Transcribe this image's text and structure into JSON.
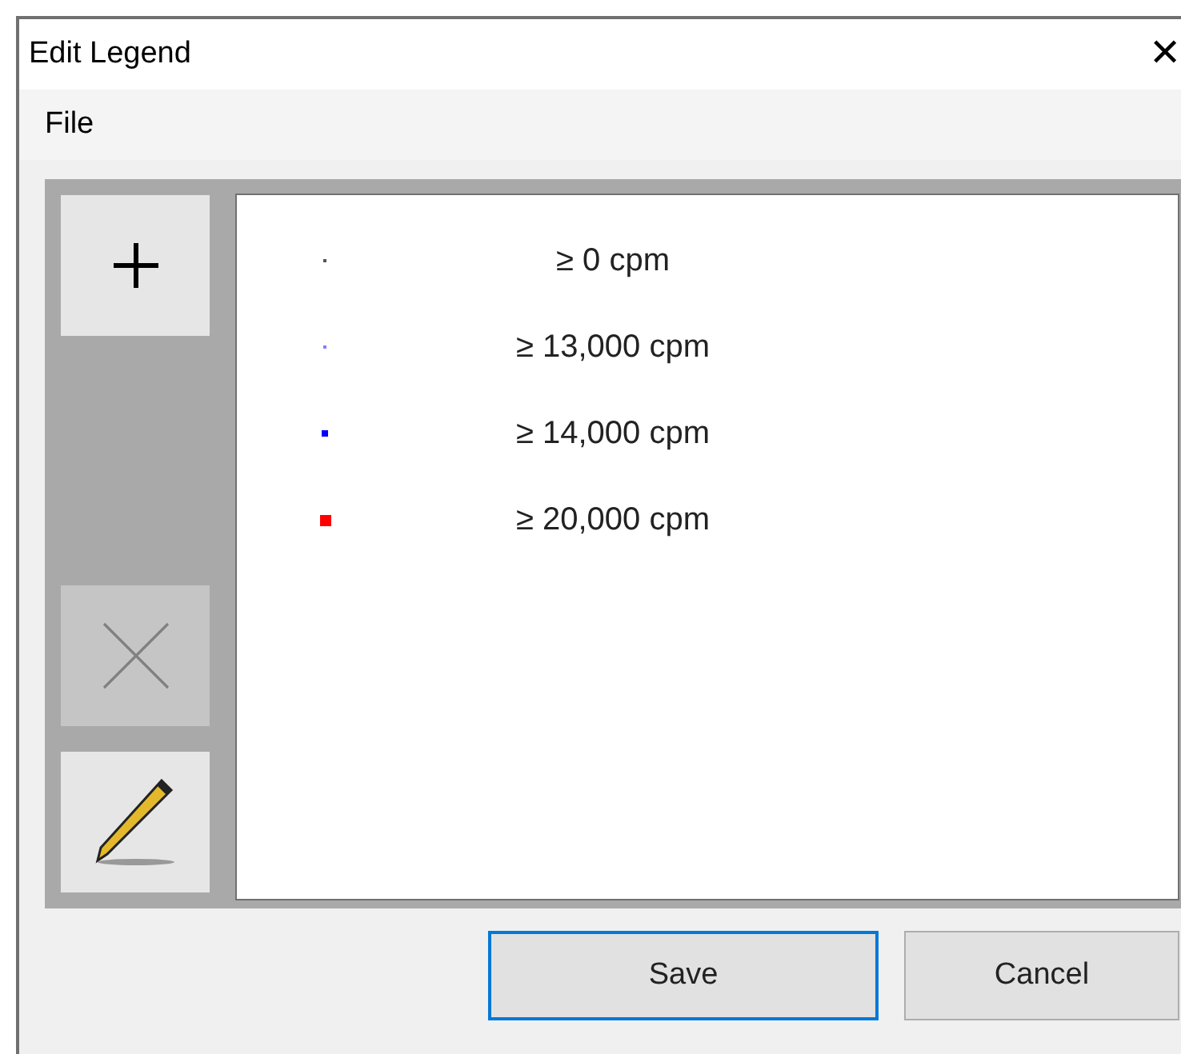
{
  "window": {
    "title": "Edit Legend",
    "close": "✕"
  },
  "menu": [
    {
      "label": "File"
    }
  ],
  "tools": [
    {
      "kind": "add",
      "disabled": false
    },
    {
      "kind": "delete",
      "disabled": true
    },
    {
      "kind": "edit",
      "disabled": false
    }
  ],
  "legend": [
    {
      "label": "≥ 0 cpm",
      "color": "#555555",
      "kind": "tiny"
    },
    {
      "label": "≥ 13,000 cpm",
      "color": "#8080ff",
      "kind": "tiny"
    },
    {
      "label": "≥ 14,000 cpm",
      "color": "#0000ff",
      "kind": "small"
    },
    {
      "label": "≥ 20,000 cpm",
      "color": "#ff0000",
      "kind": "large"
    }
  ],
  "buttons": [
    {
      "label": "Save",
      "selected": true
    },
    {
      "label": "Cancel",
      "selected": false
    }
  ]
}
